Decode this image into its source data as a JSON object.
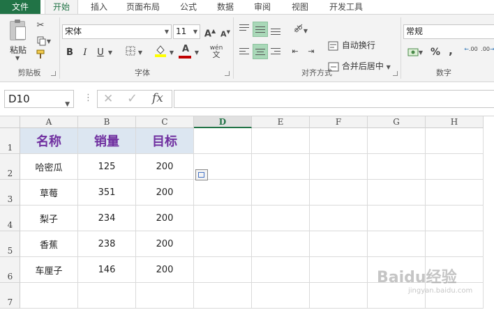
{
  "ribbon": {
    "tabs": [
      "文件",
      "开始",
      "插入",
      "页面布局",
      "公式",
      "数据",
      "审阅",
      "视图",
      "开发工具"
    ],
    "active_tab": "开始",
    "clipboard": {
      "paste_label": "粘贴",
      "group_label": "剪贴板"
    },
    "font": {
      "name": "宋体",
      "size": "11",
      "group_label": "字体",
      "bold": "B",
      "italic": "I",
      "underline": "U",
      "grow": "A",
      "shrink": "A",
      "font_color_letter": "A",
      "phonetic": "wén"
    },
    "alignment": {
      "wrap_label": "自动换行",
      "merge_label": "合并后居中",
      "group_label": "对齐方式"
    },
    "number": {
      "format": "常规",
      "group_label": "数字",
      "percent": "%",
      "comma": ",",
      "inc_decimal": ".00",
      "dec_decimal": ".00"
    }
  },
  "formula_bar": {
    "name_box": "D10",
    "fx_label": "fx",
    "cancel": "✕",
    "enter": "✓",
    "value": ""
  },
  "grid": {
    "columns": [
      "A",
      "B",
      "C",
      "D",
      "E",
      "F",
      "G",
      "H"
    ],
    "selected_column": "D",
    "rows": [
      "1",
      "2",
      "3",
      "4",
      "5",
      "6",
      "7"
    ],
    "header_row": [
      "名称",
      "销量",
      "目标"
    ],
    "data": [
      [
        "哈密瓜",
        "125",
        "200"
      ],
      [
        "草莓",
        "351",
        "200"
      ],
      [
        "梨子",
        "234",
        "200"
      ],
      [
        "香蕉",
        "238",
        "200"
      ],
      [
        "车厘子",
        "146",
        "200"
      ]
    ]
  },
  "colors": {
    "accent": "#217346",
    "header_fill": "#dce6f1",
    "header_text": "#7030a0",
    "fill_yellow": "#ffff00",
    "font_red": "#c00000"
  },
  "watermark": {
    "brand": "Baidu经验",
    "url": "jingyan.baidu.com"
  }
}
